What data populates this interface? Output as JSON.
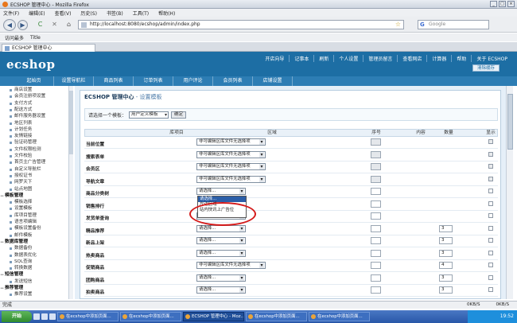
{
  "window": {
    "title": "ECSHOP 管理中心 - Mozilla Firefox",
    "buttons": [
      "_",
      "□",
      "×"
    ]
  },
  "menubar": [
    "文件(F)",
    "编辑(E)",
    "查看(V)",
    "历史(S)",
    "书签(B)",
    "工具(T)",
    "帮助(H)"
  ],
  "navbar": {
    "back": "◀",
    "forward": "▶",
    "reload": "C",
    "stop": "✕",
    "home": "⌂",
    "url": "http://localhost:8080/ecshop/admin/index.php",
    "search_placeholder": "Google"
  },
  "bookmarks": [
    "访问最多",
    "Title"
  ],
  "tab": {
    "label": "ECSHOP 管理中心"
  },
  "ecshop": {
    "logo": "ecshop",
    "toplinks": [
      "开店向导",
      "记事本",
      "刷新",
      "个人设置",
      "管理员留言",
      "查看网店",
      "计算器",
      "帮助",
      "关于 ECSHOP"
    ],
    "clear_cache": "清除缓存",
    "mainnav": [
      "起始页",
      "设置导航栏",
      "商品列表",
      "订单列表",
      "用户评论",
      "会员列表",
      "店铺设置"
    ]
  },
  "sidebar": {
    "items": [
      {
        "type": "item",
        "label": "商店设置"
      },
      {
        "type": "item",
        "label": "会员注册项设置"
      },
      {
        "type": "item",
        "label": "支付方式"
      },
      {
        "type": "item",
        "label": "配送方式"
      },
      {
        "type": "item",
        "label": "邮件服务器设置"
      },
      {
        "type": "item",
        "label": "地区列表"
      },
      {
        "type": "item",
        "label": "计划任务"
      },
      {
        "type": "item",
        "label": "友情链接"
      },
      {
        "type": "item",
        "label": "验证码管理"
      },
      {
        "type": "item",
        "label": "文件权限检测"
      },
      {
        "type": "item",
        "label": "文件校验"
      },
      {
        "type": "item",
        "label": "首页主广告管理"
      },
      {
        "type": "item",
        "label": "自定义导航栏"
      },
      {
        "type": "item",
        "label": "授权证书"
      },
      {
        "type": "item",
        "label": "网罗天下"
      },
      {
        "type": "item",
        "label": "站点地图"
      },
      {
        "type": "group",
        "label": "模板管理"
      },
      {
        "type": "item",
        "label": "模板选择"
      },
      {
        "type": "item",
        "label": "设置模板"
      },
      {
        "type": "item",
        "label": "库项目管理"
      },
      {
        "type": "item",
        "label": "语言项编辑"
      },
      {
        "type": "item",
        "label": "模板设置备份"
      },
      {
        "type": "item",
        "label": "邮件模板"
      },
      {
        "type": "group",
        "label": "数据库管理"
      },
      {
        "type": "item",
        "label": "数据备份"
      },
      {
        "type": "item",
        "label": "数据表优化"
      },
      {
        "type": "item",
        "label": "SQL查询"
      },
      {
        "type": "item",
        "label": "转换数据"
      },
      {
        "type": "group",
        "label": "短信管理"
      },
      {
        "type": "item",
        "label": "发送短信"
      },
      {
        "type": "group",
        "label": "推荐管理"
      },
      {
        "type": "item",
        "label": "推荐设置"
      }
    ]
  },
  "main": {
    "title": "ECSHOP 管理中心",
    "title_sub": " - 设置模板",
    "select_label": "请选择一个模板：",
    "template_value": "用户定义模板",
    "confirm": "确定",
    "columns": [
      "库项目",
      "区域",
      "序号",
      "内容",
      "数量",
      "显示"
    ],
    "rows": [
      {
        "lib": "当前位置",
        "region": "非可编辑区库文件无选择项",
        "short": false,
        "qty": "",
        "disabled": true
      },
      {
        "lib": "搜索表单",
        "region": "非可编辑区库文件无选择项",
        "short": false,
        "qty": "",
        "disabled": true
      },
      {
        "lib": "会员区",
        "region": "非可编辑区库文件无选择项",
        "short": false,
        "qty": "",
        "disabled": true
      },
      {
        "lib": "导航文章",
        "region": "非可编辑区库文件无选择项",
        "short": false,
        "qty": "",
        "disabled": true
      },
      {
        "lib": "商品分类树",
        "region": "请选择...",
        "short": true,
        "qty": "",
        "disabled": false
      },
      {
        "lib": "销售排行",
        "region": "",
        "short": true,
        "qty": "",
        "disabled": false
      },
      {
        "lib": "发货单查询",
        "region": "请选择...",
        "short": true,
        "qty": "",
        "disabled": false
      },
      {
        "lib": "精品推荐",
        "region": "请选择...",
        "short": true,
        "qty": "3",
        "disabled": false
      },
      {
        "lib": "新品上架",
        "region": "请选择...",
        "short": true,
        "qty": "3",
        "disabled": false
      },
      {
        "lib": "热卖商品",
        "region": "请选择...",
        "short": true,
        "qty": "3",
        "disabled": false
      },
      {
        "lib": "促销商品",
        "region": "非可编辑区库文件无选择项",
        "short": false,
        "qty": "4",
        "disabled": false
      },
      {
        "lib": "团购商品",
        "region": "请选择...",
        "short": true,
        "qty": "3",
        "disabled": false
      },
      {
        "lib": "拍卖商品",
        "region": "请选择...",
        "short": true,
        "qty": "3",
        "disabled": false
      }
    ],
    "dropdown_options": [
      "请选择...",
      "左边区域",
      "站内快讯上广告位"
    ],
    "dropdown_selected_index": 0
  },
  "status": {
    "text": "完成",
    "right": [
      "0KB/S",
      "0KB/S"
    ]
  },
  "taskbar": {
    "start": "开始",
    "items": [
      "在ecshop中添加页面...",
      "在ecshop中添加页面...",
      "ECSHOP 管理中心 - Moz...",
      "在ecshop中添加页面...",
      "在ecshop中添加页面..."
    ],
    "active_index": 2,
    "clock": "19:52"
  },
  "colors": {
    "header_blue": "#1d6ea4",
    "nav_blue": "#2d7db4",
    "highlight_red": "#d41a1a"
  }
}
